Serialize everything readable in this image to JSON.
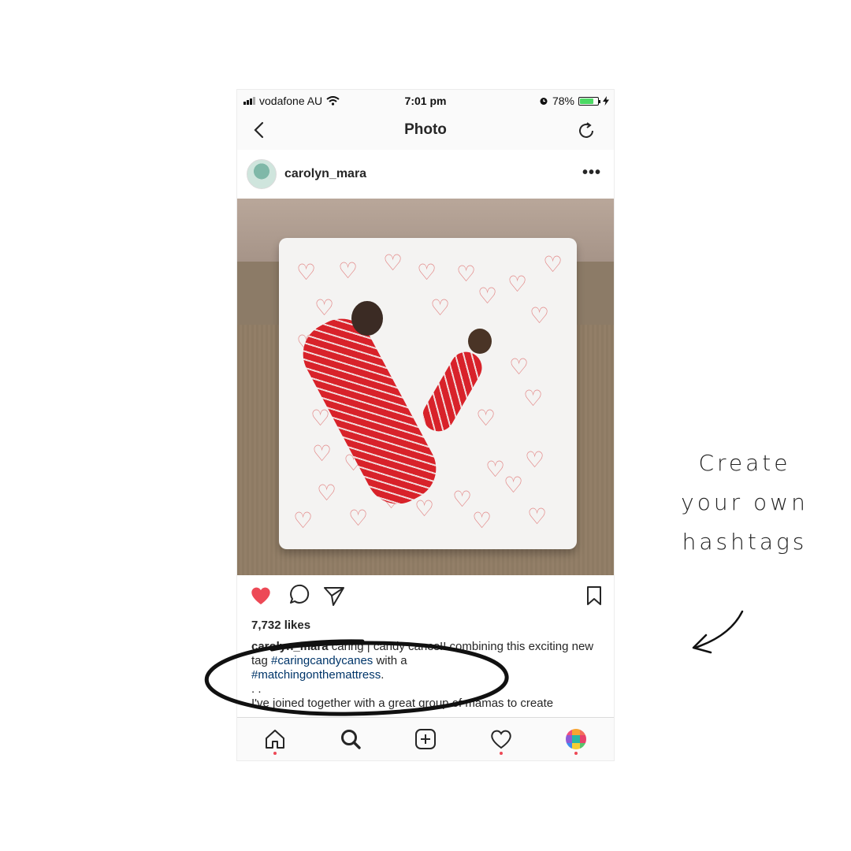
{
  "status_bar": {
    "carrier": "vodafone AU",
    "time": "7:01 pm",
    "battery_percent": "78%",
    "battery_level": 0.78
  },
  "nav": {
    "title": "Photo"
  },
  "post": {
    "username": "carolyn_mara",
    "likes": "7,732 likes",
    "caption_user": "carolyn_mara",
    "caption_text_1": " caring | candy canes!! combining this exciting new tag ",
    "hashtag_1": "#caringcandycanes",
    "caption_text_2": " with a ",
    "hashtag_2": "#matchingonthemattress",
    "caption_text_3": ".",
    "caption_dots": ". .",
    "caption_line_next": "I've joined together with a great group of mamas to create"
  },
  "annotation": {
    "text": "Create your own hashtags"
  },
  "colors": {
    "like_red": "#ed4956",
    "hashtag_blue": "#003569",
    "battery_green": "#4cd964"
  },
  "icons": [
    "back-icon",
    "refresh-icon",
    "more-icon",
    "heart-icon",
    "comment-icon",
    "share-icon",
    "bookmark-icon",
    "home-icon",
    "search-icon",
    "add-icon",
    "activity-icon",
    "profile-icon"
  ]
}
